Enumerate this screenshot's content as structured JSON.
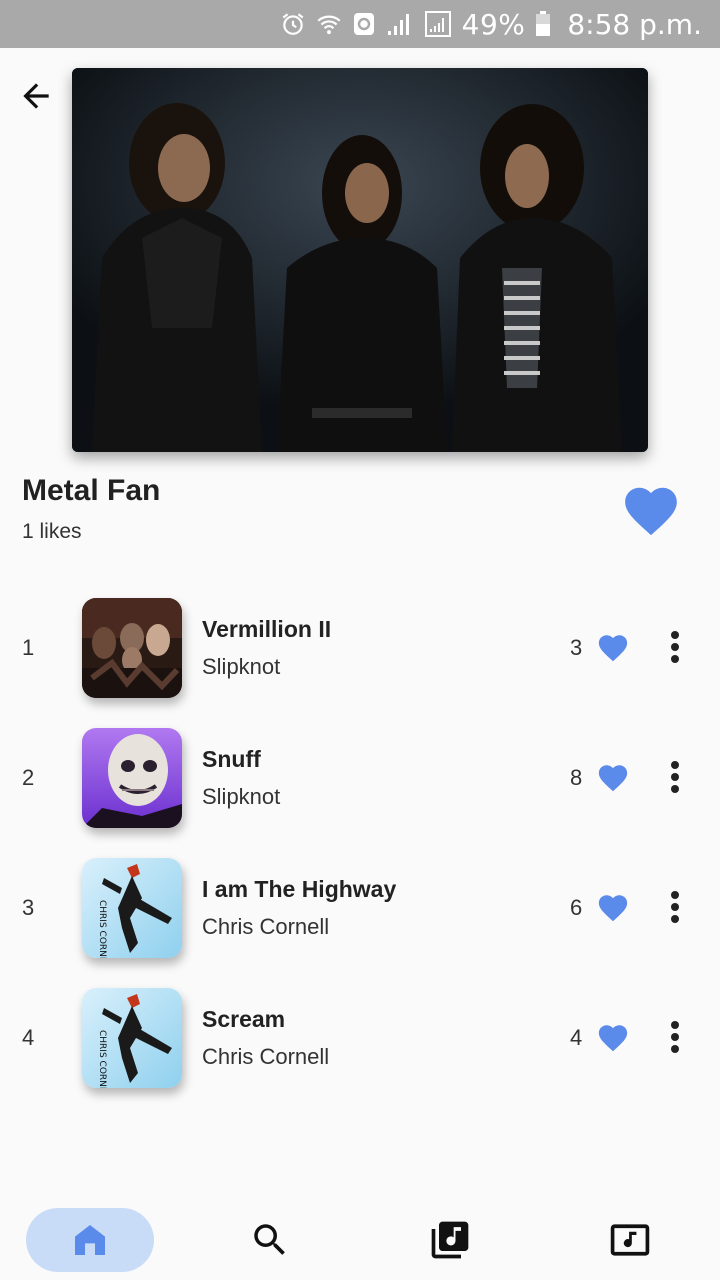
{
  "status_bar": {
    "battery": "49%",
    "time": "8:58 p.m."
  },
  "header": {
    "back_icon": "arrow-back-icon",
    "cover_image": "band-photo"
  },
  "playlist": {
    "title": "Metal Fan",
    "likes": "1 likes",
    "liked": true
  },
  "tracks": [
    {
      "number": "1",
      "title": "Vermillion II",
      "artist": "Slipknot",
      "likes": "3",
      "art": "slipknot-cover"
    },
    {
      "number": "2",
      "title": "Snuff",
      "artist": "Slipknot",
      "likes": "8",
      "art": "mask-cover"
    },
    {
      "number": "3",
      "title": "I am The Highway",
      "artist": "Chris Cornell",
      "likes": "6",
      "art": "chris-cornell-scream-cover"
    },
    {
      "number": "4",
      "title": "Scream",
      "artist": "Chris Cornell",
      "likes": "4",
      "art": "chris-cornell-scream-cover"
    }
  ],
  "album_art_text": "CHRIS CORNELL SCREAM",
  "bottom_nav": {
    "active": "home",
    "items": [
      "home-icon",
      "search-icon",
      "library-music-icon",
      "music-player-icon"
    ]
  },
  "colors": {
    "accent": "#5b8bea",
    "status_bar": "#a9a9a9",
    "nav_active_bg": "#c9dcf7",
    "background": "#fafafa"
  }
}
